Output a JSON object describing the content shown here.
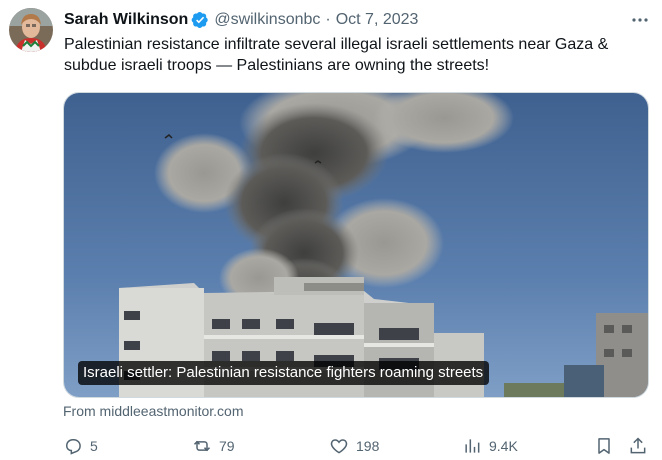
{
  "tweet": {
    "author_name": "Sarah Wilkinson",
    "handle": "@swilkinsonbc",
    "separator": "·",
    "date": "Oct 7, 2023",
    "text": "Palestinian resistance infiltrate several illegal israeli settlements near Gaza & subdue israeli troops — Palestinians are owning the streets!",
    "media_caption": "Israeli settler: Palestinian resistance fighters roaming streets",
    "source": "From middleeastmonitor.com"
  },
  "actions": {
    "replies": "5",
    "reposts": "79",
    "likes": "198",
    "views": "9.4K"
  },
  "icons": {
    "verified": "verified-badge-icon",
    "more": "more-icon",
    "reply": "reply-icon",
    "repost": "repost-icon",
    "like": "heart-icon",
    "views": "views-icon",
    "bookmark": "bookmark-icon",
    "share": "share-icon"
  },
  "colors": {
    "verified": "#1d9bf0",
    "secondary_text": "#536471",
    "primary_text": "#0f1419"
  }
}
